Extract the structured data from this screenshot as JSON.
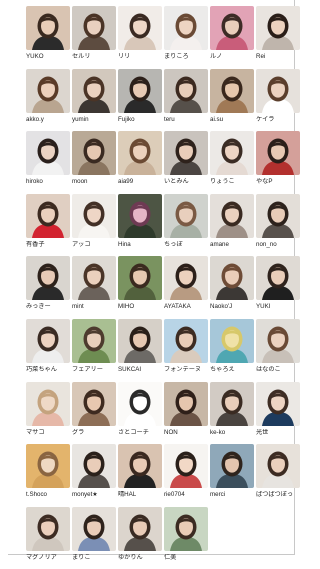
{
  "members": [
    {
      "name": "YUKO",
      "bg": "#d9c4b2",
      "hair": "#3a2a20",
      "skin": "#e8cdb8",
      "cloth": "#2b2b2b"
    },
    {
      "name": "セルリ",
      "bg": "#cfc9c2",
      "hair": "#4a3426",
      "skin": "#e9d0bf",
      "cloth": "#5d4c40"
    },
    {
      "name": "リリ",
      "bg": "#f1ece8",
      "hair": "#3a2a22",
      "skin": "#eed7c7",
      "cloth": "#d8c7b9"
    },
    {
      "name": "まりころ",
      "bg": "#ecebea",
      "hair": "#6a4a35",
      "skin": "#edd4c2",
      "cloth": "#f4f0ee"
    },
    {
      "name": "ルノ",
      "bg": "#e2a3b6",
      "hair": "#3d2b26",
      "skin": "#e9cdbb",
      "cloth": "#c95d7a"
    },
    {
      "name": "Rei",
      "bg": "#e9e4df",
      "hair": "#2a1e18",
      "skin": "#ecd2bf",
      "cloth": "#bfb5ac"
    },
    {
      "name": "akko.y",
      "bg": "#dcd6cf",
      "hair": "#5a3b28",
      "skin": "#ecd0bc",
      "cloth": "#b9a590"
    },
    {
      "name": "yumin",
      "bg": "#d2c8bd",
      "hair": "#4b3426",
      "skin": "#ebd1bf",
      "cloth": "#3c3632"
    },
    {
      "name": "Fujiko",
      "bg": "#b7b6b2",
      "hair": "#2c201a",
      "skin": "#e7cab4",
      "cloth": "#2a2a2a"
    },
    {
      "name": "teru",
      "bg": "#ccc6bf",
      "hair": "#3c2a20",
      "skin": "#e8cdb9",
      "cloth": "#56504a"
    },
    {
      "name": "ai.su",
      "bg": "#c7b4a0",
      "hair": "#3a281d",
      "skin": "#e6c7ad",
      "cloth": "#a07956"
    },
    {
      "name": "ケイラ",
      "bg": "#e6e1dc",
      "hair": "#5b3e2c",
      "skin": "#ecd2c0",
      "cloth": "#ffffff"
    },
    {
      "name": "hiroko",
      "bg": "#e3e2e4",
      "hair": "#2a201c",
      "skin": "#ebd3c3",
      "cloth": "#f2f2f2"
    },
    {
      "name": "moon",
      "bg": "#b9a996",
      "hair": "#3a2a21",
      "skin": "#e5c8b2",
      "cloth": "#8a7560"
    },
    {
      "name": "aia99",
      "bg": "#dccdb9",
      "hair": "#6b4a33",
      "skin": "#ecd1bc",
      "cloth": "#c9b29a"
    },
    {
      "name": "いとみん",
      "bg": "#c9c3bd",
      "hair": "#2e221c",
      "skin": "#e9cdb9",
      "cloth": "#4b4542"
    },
    {
      "name": "りょうこ",
      "bg": "#ece9e6",
      "hair": "#3b2c24",
      "skin": "#edd4c3",
      "cloth": "#e5dad3"
    },
    {
      "name": "やなP",
      "bg": "#d4a09a",
      "hair": "#2b1f1a",
      "skin": "#e8c9b4",
      "cloth": "#b3302e"
    },
    {
      "name": "有香子",
      "bg": "#e0cfc2",
      "hair": "#3c2a20",
      "skin": "#ebd0bd",
      "cloth": "#d2232f"
    },
    {
      "name": "アッコ",
      "bg": "#efece8",
      "hair": "#433026",
      "skin": "#eed6c6",
      "cloth": "#f7f5f2"
    },
    {
      "name": "Hina",
      "bg": "#4d5544",
      "hair": "#6e3a53",
      "skin": "#e7b5c7",
      "cloth": "#2e3a2b"
    },
    {
      "name": "ちっぽ",
      "bg": "#cfd2cd",
      "hair": "#7a5a44",
      "skin": "#e8cfbd",
      "cloth": "#a7b0a5"
    },
    {
      "name": "amane",
      "bg": "#e4dfda",
      "hair": "#3a2a21",
      "skin": "#ebd1bf",
      "cloth": "#9e9087"
    },
    {
      "name": "non_no",
      "bg": "#e3ded8",
      "hair": "#2d221c",
      "skin": "#e8ccb8",
      "cloth": "#58514c"
    },
    {
      "name": "みっきー",
      "bg": "#d9d5cf",
      "hair": "#2d221b",
      "skin": "#e7cab6",
      "cloth": "#2a2a2a"
    },
    {
      "name": "mint",
      "bg": "#dedad4",
      "hair": "#4a3528",
      "skin": "#ebd0bd",
      "cloth": "#6b625b"
    },
    {
      "name": "MIHO",
      "bg": "#7a9360",
      "hair": "#3a2a1f",
      "skin": "#e6c8b0",
      "cloth": "#52613d"
    },
    {
      "name": "AYATAKA",
      "bg": "#e7e2dc",
      "hair": "#2c201a",
      "skin": "#ecd1be",
      "cloth": "#b89b82"
    },
    {
      "name": "Naoko'J",
      "bg": "#dcd8d2",
      "hair": "#6e4c37",
      "skin": "#eacdb9",
      "cloth": "#3c3835"
    },
    {
      "name": "YUKI",
      "bg": "#dfdad4",
      "hair": "#2f231d",
      "skin": "#e9cdb9",
      "cloth": "#1f1f1f"
    },
    {
      "name": "巧菜ちゃん",
      "bg": "#e1dcd7",
      "hair": "#3a2b23",
      "skin": "#ecd2c0",
      "cloth": "#eeeeee"
    },
    {
      "name": "フェアリー",
      "bg": "#a9bf92",
      "hair": "#4d3b2e",
      "skin": "#e9cfbc",
      "cloth": "#6e8d52"
    },
    {
      "name": "SUKCAI",
      "bg": "#d6d0c8",
      "hair": "#2a1f19",
      "skin": "#e6c8b2",
      "cloth": "#6d6a66"
    },
    {
      "name": "フォンテーヌ",
      "bg": "#b8d4e6",
      "hair": "#3d2c22",
      "skin": "#e9cdb8",
      "cloth": "#d9cbbd"
    },
    {
      "name": "ちゃろえ",
      "bg": "#a6c7d9",
      "hair": "#d7c86a",
      "skin": "#f0e2a8",
      "cloth": "#4fa7b2"
    },
    {
      "name": "はなのこ",
      "bg": "#e0ddd8",
      "hair": "#6a4a36",
      "skin": "#ecd2c0",
      "cloth": "#c8c0b8"
    },
    {
      "name": "マサコ",
      "bg": "#e9e4dd",
      "hair": "#c4a37e",
      "skin": "#efd9c6",
      "cloth": "#e6b8a8"
    },
    {
      "name": "グラ",
      "bg": "#d8c7b7",
      "hair": "#3e2b20",
      "skin": "#e8c8b0",
      "cloth": "#8d6e56"
    },
    {
      "name": "さとコーチ",
      "bg": "#fbfaf8",
      "hair": "#2a2a2a",
      "skin": "#ffffff",
      "cloth": "#ffffff"
    },
    {
      "name": "NON",
      "bg": "#c7b7a6",
      "hair": "#2f2019",
      "skin": "#e5c6ae",
      "cloth": "#6b5446"
    },
    {
      "name": "ke-ko",
      "bg": "#d2cbc4",
      "hair": "#3a2b22",
      "skin": "#e9ceba",
      "cloth": "#4a4440"
    },
    {
      "name": "光世",
      "bg": "#ebe8e4",
      "hair": "#3e2d24",
      "skin": "#edd4c3",
      "cloth": "#1d3b5e"
    },
    {
      "name": "t.Shoco",
      "bg": "#e3b46c",
      "hair": "#8a6541",
      "skin": "#efd9c2",
      "cloth": "#d4a25b"
    },
    {
      "name": "monyet★",
      "bg": "#e8e5e1",
      "hair": "#2b211b",
      "skin": "#e9cdb9",
      "cloth": "#56504c"
    },
    {
      "name": "晴HAL",
      "bg": "#d9c3b1",
      "hair": "#3a2920",
      "skin": "#e9cbb6",
      "cloth": "#222222"
    },
    {
      "name": "rie0704",
      "bg": "#f6f4f1",
      "hair": "#2a201a",
      "skin": "#f2d8c6",
      "cloth": "#c94a4a"
    },
    {
      "name": "merci",
      "bg": "#8fa8b9",
      "hair": "#2f241d",
      "skin": "#e3c4ae",
      "cloth": "#3b4e5c"
    },
    {
      "name": "ぱつぱつぼっ",
      "bg": "#e7e1da",
      "hair": "#3c2b22",
      "skin": "#ebd0bd",
      "cloth": "#e7e4e0"
    },
    {
      "name": "マグノリア",
      "bg": "#ddd7cf",
      "hair": "#3d2c23",
      "skin": "#ebcfbc",
      "cloth": "#cfc7be"
    },
    {
      "name": "まりこ",
      "bg": "#e5e0da",
      "hair": "#2f231c",
      "skin": "#eacdb9",
      "cloth": "#7b8fb5"
    },
    {
      "name": "ゆかりん",
      "bg": "#dcd5cd",
      "hair": "#392a22",
      "skin": "#e8cbb7",
      "cloth": "#56504b"
    },
    {
      "name": "仁美",
      "bg": "#c8d6c2",
      "hair": "#3b2b22",
      "skin": "#e9ccb7",
      "cloth": "#6e8a67"
    }
  ]
}
